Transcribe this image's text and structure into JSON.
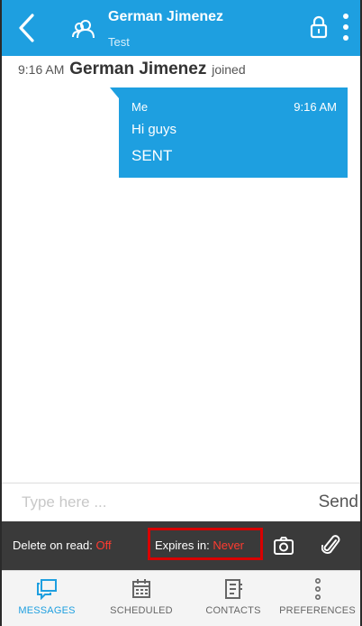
{
  "header": {
    "title": "German Jimenez",
    "subtitle": "Test"
  },
  "conversation": {
    "system_event": {
      "time": "9:16 AM",
      "name": "German Jimenez",
      "action": "joined"
    },
    "messages": [
      {
        "sender": "Me",
        "time": "9:16 AM",
        "text": "Hi guys",
        "status": "SENT"
      }
    ]
  },
  "composer": {
    "placeholder": "Type here ...",
    "send_label": "Send"
  },
  "options": {
    "delete_on_read_label": "Delete on read:",
    "delete_on_read_value": "Off",
    "expires_label": "Expires in:",
    "expires_value": "Never"
  },
  "tabs": [
    {
      "label": "MESSAGES",
      "icon": "messages-icon",
      "active": true
    },
    {
      "label": "SCHEDULED",
      "icon": "calendar-icon",
      "active": false
    },
    {
      "label": "CONTACTS",
      "icon": "contacts-icon",
      "active": false
    },
    {
      "label": "PREFERENCES",
      "icon": "kebab-icon",
      "active": false
    }
  ],
  "colors": {
    "accent": "#1e9fe0",
    "option_bar": "#3a3a3a",
    "warning": "#ff3b30",
    "highlight_box": "#d80000"
  }
}
